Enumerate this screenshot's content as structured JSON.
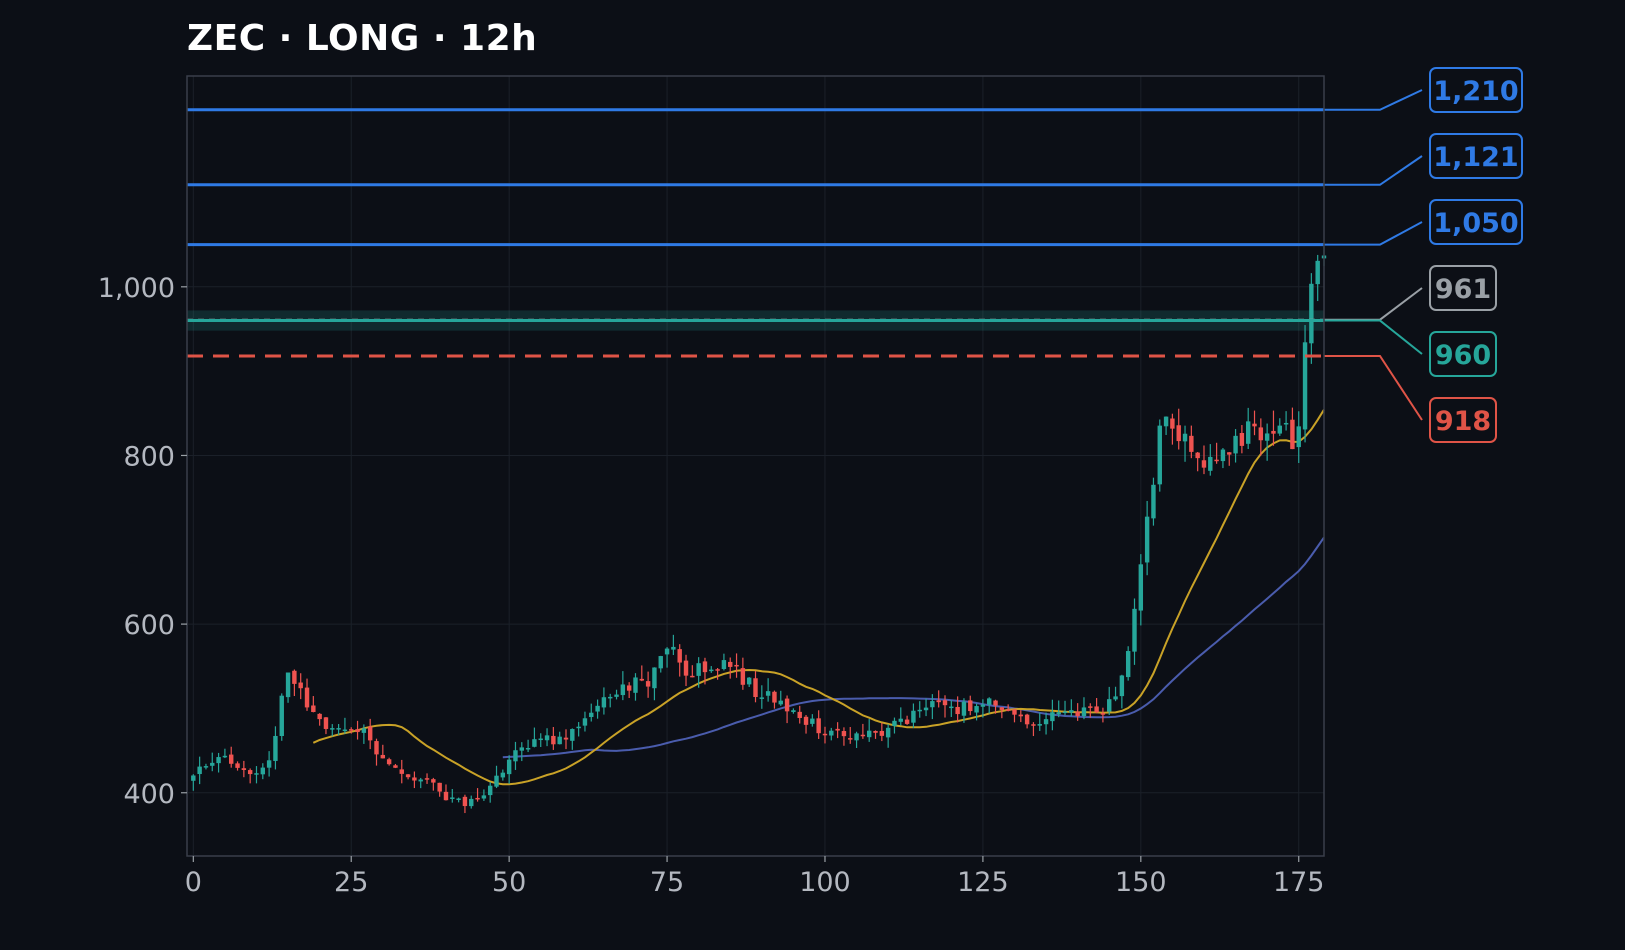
{
  "chart_data": {
    "type": "candlestick",
    "title": "ZEC · LONG · 12h",
    "xlabel": "",
    "ylabel": "",
    "xlim": [
      -1,
      179
    ],
    "ylim": [
      325,
      1250
    ],
    "x_ticks": [
      0,
      25,
      50,
      75,
      100,
      125,
      150,
      175
    ],
    "y_ticks": [
      400,
      600,
      800,
      1000
    ],
    "y_tick_labels": [
      "400",
      "600",
      "800",
      "1,000"
    ],
    "grid": true,
    "colors": {
      "background": "#0c0f16",
      "up": "#26a69a",
      "down": "#ef5350",
      "ma_fast": "#c9a227",
      "ma_slow": "#4a5cad",
      "take_profit": "#2f7ae5",
      "entry": "#26a69a",
      "current": "#9aa0a6",
      "stop": "#e05447"
    },
    "price_keypoints": [
      [
        0,
        420
      ],
      [
        5,
        445
      ],
      [
        8,
        425
      ],
      [
        12,
        432
      ],
      [
        14,
        515
      ],
      [
        15,
        540
      ],
      [
        18,
        505
      ],
      [
        22,
        475
      ],
      [
        27,
        470
      ],
      [
        30,
        440
      ],
      [
        35,
        420
      ],
      [
        38,
        405
      ],
      [
        43,
        385
      ],
      [
        46,
        395
      ],
      [
        50,
        440
      ],
      [
        55,
        460
      ],
      [
        58,
        465
      ],
      [
        62,
        490
      ],
      [
        66,
        515
      ],
      [
        70,
        535
      ],
      [
        72,
        525
      ],
      [
        74,
        570
      ],
      [
        75,
        575
      ],
      [
        78,
        545
      ],
      [
        83,
        550
      ],
      [
        86,
        545
      ],
      [
        89,
        520
      ],
      [
        94,
        500
      ],
      [
        98,
        480
      ],
      [
        102,
        472
      ],
      [
        105,
        467
      ],
      [
        109,
        475
      ],
      [
        113,
        488
      ],
      [
        118,
        505
      ],
      [
        121,
        500
      ],
      [
        125,
        510
      ],
      [
        128,
        498
      ],
      [
        132,
        485
      ],
      [
        136,
        488
      ],
      [
        140,
        492
      ],
      [
        144,
        502
      ],
      [
        147,
        530
      ],
      [
        149,
        610
      ],
      [
        151,
        720
      ],
      [
        153,
        830
      ],
      [
        155,
        840
      ],
      [
        158,
        800
      ],
      [
        160,
        785
      ],
      [
        163,
        805
      ],
      [
        166,
        822
      ],
      [
        168,
        840
      ],
      [
        170,
        825
      ],
      [
        172,
        845
      ],
      [
        174,
        805
      ],
      [
        175,
        835
      ],
      [
        176,
        950
      ],
      [
        177,
        1000
      ],
      [
        178,
        1020
      ]
    ],
    "candle_count": 180,
    "ma_fast_period": 20,
    "ma_slow_period": 50,
    "levels": [
      {
        "label": "1,210",
        "value": 1210,
        "kind": "take_profit",
        "style": "solid"
      },
      {
        "label": "1,121",
        "value": 1121,
        "kind": "take_profit",
        "style": "solid"
      },
      {
        "label": "1,050",
        "value": 1050,
        "kind": "take_profit",
        "style": "solid"
      },
      {
        "label": "961",
        "value": 961,
        "kind": "current",
        "style": "dashed"
      },
      {
        "label": "960",
        "value": 960,
        "kind": "entry",
        "style": "solid",
        "zone": [
          948,
          972
        ]
      },
      {
        "label": "918",
        "value": 918,
        "kind": "stop",
        "style": "dashed"
      }
    ]
  }
}
